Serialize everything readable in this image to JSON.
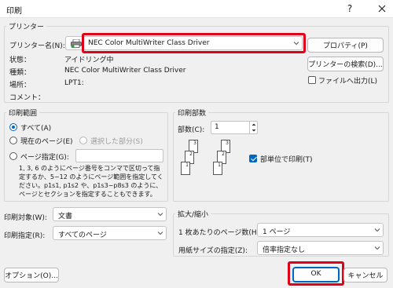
{
  "window": {
    "title": "印刷",
    "help_glyph": "?"
  },
  "printer": {
    "group_label": "プリンター",
    "name_label": "プリンター名(N):",
    "name_value": "NEC Color MultiWriter Class Driver",
    "properties_button": "プロパティ(P)",
    "status_label": "状態：",
    "status_value": "アイドリング中",
    "type_label": "種類：",
    "type_value": "NEC Color MultiWriter Class Driver",
    "location_label": "場所：",
    "location_value": "LPT1:",
    "comment_label": "コメント：",
    "find_button": "プリンターの検索(D)...",
    "print_to_file_label": "ファイルへ出力(L)",
    "print_to_file_checked": false
  },
  "range": {
    "group_label": "印刷範囲",
    "all_label": "すべて(A)",
    "current_label": "現在のページ(E)",
    "selection_label": "選択した部分(S)",
    "pages_label": "ページ指定(G):",
    "pages_value": "",
    "selected": "all",
    "help_text": [
      "1, 3, 6 のようにページ番号をコンマで区切って指",
      "定するか、5−12 のようにページ範囲を指定してく",
      "ださい。p1s1, p1s2 や、p1s3−p8s3 のように、",
      "ページとセクションを指定することもできます。"
    ]
  },
  "copies": {
    "group_label": "印刷部数",
    "count_label": "部数(C):",
    "count_value": "1",
    "collate_label": "部単位で印刷(T)",
    "collate_checked": true,
    "page_numbers": [
      "1",
      "2",
      "3",
      "1",
      "2",
      "3"
    ]
  },
  "print_what": {
    "label": "印刷対象(W):",
    "value": "文書"
  },
  "print_option": {
    "label": "印刷指定(R):",
    "value": "すべてのページ"
  },
  "zoom": {
    "group_label": "拡大/縮小",
    "pages_per_sheet_label": "1 枚あたりのページ数(H):",
    "pages_per_sheet_value": "1 ページ",
    "scale_label": "用紙サイズの指定(Z):",
    "scale_value": "倍率指定なし"
  },
  "footer": {
    "options_button": "オプション(O)...",
    "ok_button": "OK",
    "cancel_button": "キャンセル"
  },
  "colors": {
    "accent": "#0067c0",
    "highlight": "#e0001a"
  }
}
